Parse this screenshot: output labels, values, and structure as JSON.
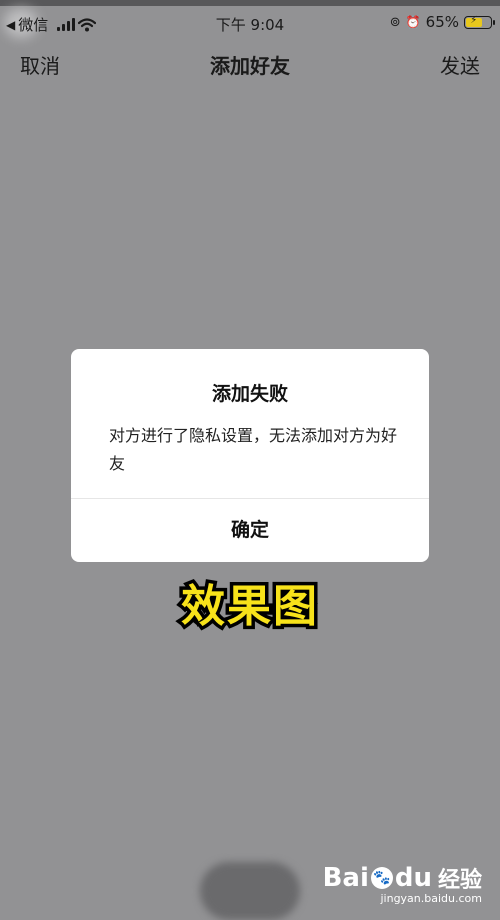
{
  "status_bar": {
    "back_arrow": "◀",
    "carrier": "微信",
    "time": "下午 9:04",
    "orientation_lock_glyph": "⊚",
    "alarm_glyph": "⏰",
    "battery_percent": "65%",
    "battery_level": 0.65,
    "charging_glyph": "⚡"
  },
  "nav": {
    "cancel": "取消",
    "title": "添加好友",
    "send": "发送"
  },
  "dialog": {
    "title": "添加失败",
    "message": "对方进行了隐私设置，无法添加对方为好友",
    "confirm": "确定"
  },
  "caption": "效果图",
  "watermark": {
    "brand": "Bai",
    "brand_tail": "du",
    "paw_glyph": "🐾",
    "suffix": "经验",
    "url": "jingyan.baidu.com"
  },
  "colors": {
    "overlay": "#929294",
    "caption_fill": "#f7e21a",
    "battery": "#e8c81d"
  }
}
